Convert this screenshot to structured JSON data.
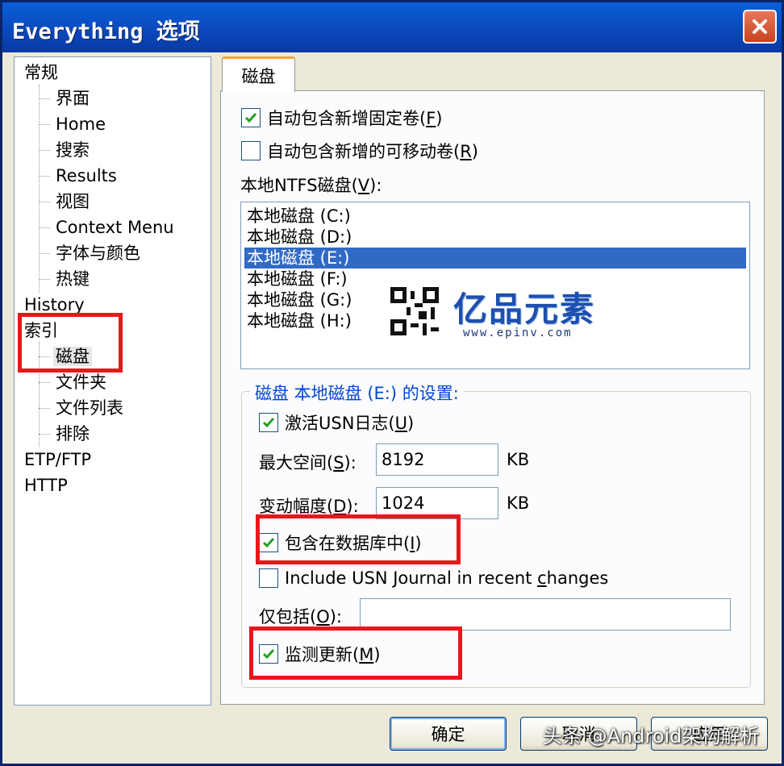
{
  "window": {
    "title": "Everything 选项"
  },
  "tree": {
    "items": [
      {
        "label": "常规",
        "level": 1
      },
      {
        "label": "界面",
        "level": 2
      },
      {
        "label": "Home",
        "level": 2
      },
      {
        "label": "搜索",
        "level": 2
      },
      {
        "label": "Results",
        "level": 2
      },
      {
        "label": "视图",
        "level": 2
      },
      {
        "label": "Context Menu",
        "level": 2
      },
      {
        "label": "字体与颜色",
        "level": 2
      },
      {
        "label": "热键",
        "level": 2
      },
      {
        "label": "History",
        "level": 1
      },
      {
        "label": "索引",
        "level": 1
      },
      {
        "label": "磁盘",
        "level": 2,
        "selected": true
      },
      {
        "label": "文件夹",
        "level": 2
      },
      {
        "label": "文件列表",
        "level": 2
      },
      {
        "label": "排除",
        "level": 2
      },
      {
        "label": "ETP/FTP",
        "level": 1
      },
      {
        "label": "HTTP",
        "level": 1
      }
    ]
  },
  "tab": {
    "label": "磁盘"
  },
  "options": {
    "auto_fixed": {
      "text": "自动包含新增固定卷(",
      "key": "F",
      "close": ")",
      "checked": true
    },
    "auto_removable": {
      "text": "自动包含新增的可移动卷(",
      "key": "R",
      "close": ")",
      "checked": false
    },
    "ntfs_label": {
      "text": "本地NTFS磁盘(",
      "key": "V",
      "close": "):"
    }
  },
  "drives": [
    {
      "label": "本地磁盘 (C:)",
      "selected": false
    },
    {
      "label": "本地磁盘 (D:)",
      "selected": false
    },
    {
      "label": "本地磁盘 (E:)",
      "selected": true
    },
    {
      "label": "本地磁盘 (F:)",
      "selected": false
    },
    {
      "label": "本地磁盘 (G:)",
      "selected": false
    },
    {
      "label": "本地磁盘 (H:)",
      "selected": false
    }
  ],
  "settings": {
    "group_title": "磁盘 本地磁盘 (E:) 的设置:",
    "enable_usn": {
      "text": "激活USN日志(",
      "key": "U",
      "close": ")",
      "checked": true
    },
    "max_size": {
      "text": "最大空间(",
      "key": "S",
      "close": "):",
      "value": "8192",
      "unit": "KB"
    },
    "delta": {
      "text": "变动幅度(",
      "key": "D",
      "close": "):",
      "value": "1024",
      "unit": "KB"
    },
    "include_db": {
      "text": "包含在数据库中(",
      "key": "I",
      "close": ")",
      "checked": true
    },
    "include_usn_recent": {
      "text": "Include USN Journal in recent ",
      "key": "c",
      "rest": "hanges",
      "checked": false
    },
    "include_only": {
      "text": "仅包括(",
      "key": "O",
      "close": "):",
      "value": ""
    },
    "monitor": {
      "text": "监测更新(",
      "key": "M",
      "close": ")",
      "checked": true
    }
  },
  "buttons": {
    "ok": "确定",
    "cancel": "取消",
    "apply": "应用"
  },
  "watermark": {
    "brand": "亿品元素",
    "url": "www.epinv.com",
    "credit": "头条 @Android架构解析"
  },
  "colors": {
    "highlight": "#e8171b",
    "selection": "#316ac5",
    "titlebar": "#0b4fc4"
  }
}
